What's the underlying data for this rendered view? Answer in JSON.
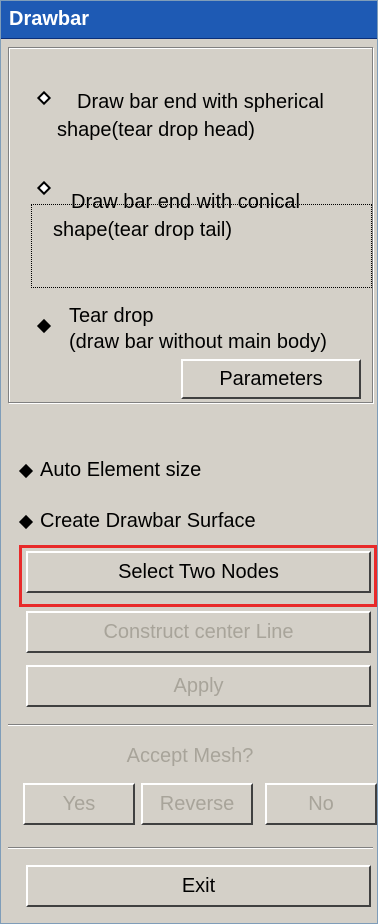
{
  "window": {
    "title": "Drawbar"
  },
  "shape_options": [
    {
      "line1": "Draw bar end with spherical",
      "line2": "shape(tear drop head)",
      "selected": false
    },
    {
      "line1": "Draw bar end with conical",
      "line2": "shape(tear drop tail)",
      "selected": false
    },
    {
      "line1": "Tear drop",
      "line2": "(draw bar without main body)",
      "selected": true
    }
  ],
  "buttons": {
    "parameters": "Parameters",
    "select_two_nodes": "Select Two Nodes",
    "construct_center_line": "Construct center Line",
    "apply": "Apply",
    "yes": "Yes",
    "reverse": "Reverse",
    "no": "No",
    "exit": "Exit"
  },
  "toggles": {
    "auto_element_size": "Auto Element size",
    "create_drawbar_surface": "Create Drawbar Surface"
  },
  "accept_mesh": {
    "label": "Accept Mesh?"
  }
}
